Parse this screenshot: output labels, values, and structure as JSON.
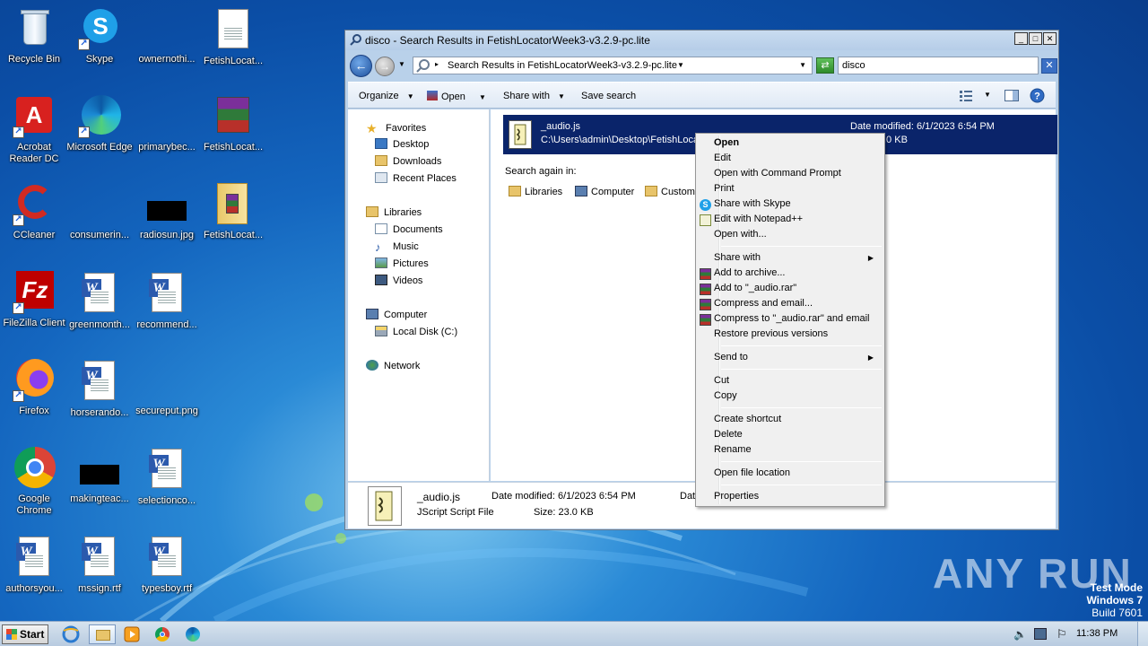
{
  "desktop": {
    "icons": [
      {
        "label": "Recycle Bin",
        "icon": "recycle-bin-icon"
      },
      {
        "label": "Skype",
        "icon": "skype-icon"
      },
      {
        "label": "ownernothi...",
        "icon": "blank-file-icon"
      },
      {
        "label": "FetishLocat...",
        "icon": "text-file-icon"
      },
      {
        "label": "Acrobat Reader DC",
        "icon": "acrobat-icon"
      },
      {
        "label": "Microsoft Edge",
        "icon": "edge-icon"
      },
      {
        "label": "primarybec...",
        "icon": "blank-file-icon"
      },
      {
        "label": "FetishLocat...",
        "icon": "winrar-archive-icon"
      },
      {
        "label": "CCleaner",
        "icon": "ccleaner-icon"
      },
      {
        "label": "consumerin...",
        "icon": "blank-file-icon"
      },
      {
        "label": "radiosun.jpg",
        "icon": "image-file-icon"
      },
      {
        "label": "FetishLocat...",
        "icon": "folder-archive-icon"
      },
      {
        "label": "FileZilla Client",
        "icon": "filezilla-icon"
      },
      {
        "label": "greenmonth...",
        "icon": "word-doc-icon"
      },
      {
        "label": "recommend...",
        "icon": "word-doc-icon"
      },
      {
        "label": "Firefox",
        "icon": "firefox-icon"
      },
      {
        "label": "horserando...",
        "icon": "word-doc-icon"
      },
      {
        "label": "secureput.png",
        "icon": "image-file-icon"
      },
      {
        "label": "Google Chrome",
        "icon": "chrome-icon"
      },
      {
        "label": "makingteac...",
        "icon": "image-file-icon"
      },
      {
        "label": "selectionco...",
        "icon": "word-doc-icon"
      },
      {
        "label": "authorsyou...",
        "icon": "word-doc-icon"
      },
      {
        "label": "mssign.rtf",
        "icon": "word-doc-icon"
      },
      {
        "label": "typesboy.rtf",
        "icon": "word-doc-icon"
      }
    ]
  },
  "window": {
    "title": "disco - Search Results in FetishLocatorWeek3-v3.2.9-pc.lite",
    "address": "Search Results in FetishLocatorWeek3-v3.2.9-pc.lite",
    "search_value": "disco",
    "toolbar": {
      "organize": "Organize",
      "open": "Open",
      "share_with": "Share with",
      "save_search": "Save search"
    },
    "nav": {
      "favorites": "Favorites",
      "desktop": "Desktop",
      "downloads": "Downloads",
      "recent_places": "Recent Places",
      "libraries": "Libraries",
      "documents": "Documents",
      "music": "Music",
      "pictures": "Pictures",
      "videos": "Videos",
      "computer": "Computer",
      "local_disk": "Local Disk (C:)",
      "network": "Network"
    },
    "result": {
      "name": "_audio.js",
      "path": "C:\\Users\\admin\\Desktop\\FetishLoca",
      "date_modified": "Date modified: 6/1/2023 6:54 PM",
      "size_fragment": ".0 KB"
    },
    "search_again": {
      "label": "Search again in:",
      "libraries": "Libraries",
      "computer": "Computer",
      "custom": "Custom"
    },
    "details": {
      "name": "_audio.js",
      "type": "JScript Script File",
      "date_modified": "Date modified: 6/1/2023 6:54 PM",
      "size": "Size: 23.0 KB",
      "date_fragment": "Dat"
    }
  },
  "context_menu": {
    "items": [
      {
        "label": "Open",
        "bold": true
      },
      {
        "label": "Edit"
      },
      {
        "label": "Open with Command Prompt"
      },
      {
        "label": "Print"
      },
      {
        "label": "Share with Skype"
      },
      {
        "label": "Edit with Notepad++"
      },
      {
        "label": "Open with..."
      },
      {
        "label": "Share with"
      },
      {
        "label": "Add to archive..."
      },
      {
        "label": "Add to \"_audio.rar\""
      },
      {
        "label": "Compress and email..."
      },
      {
        "label": "Compress to \"_audio.rar\" and email"
      },
      {
        "label": "Restore previous versions"
      },
      {
        "label": "Send to"
      },
      {
        "label": "Cut"
      },
      {
        "label": "Copy"
      },
      {
        "label": "Create shortcut"
      },
      {
        "label": "Delete"
      },
      {
        "label": "Rename"
      },
      {
        "label": "Open file location"
      },
      {
        "label": "Properties"
      }
    ]
  },
  "taskbar": {
    "start": "Start",
    "clock": "11:38 PM"
  },
  "watermark": "ANY RUN",
  "test_mode": {
    "line1": "Test Mode",
    "line2": "Windows 7",
    "line3": "Build 7601"
  }
}
